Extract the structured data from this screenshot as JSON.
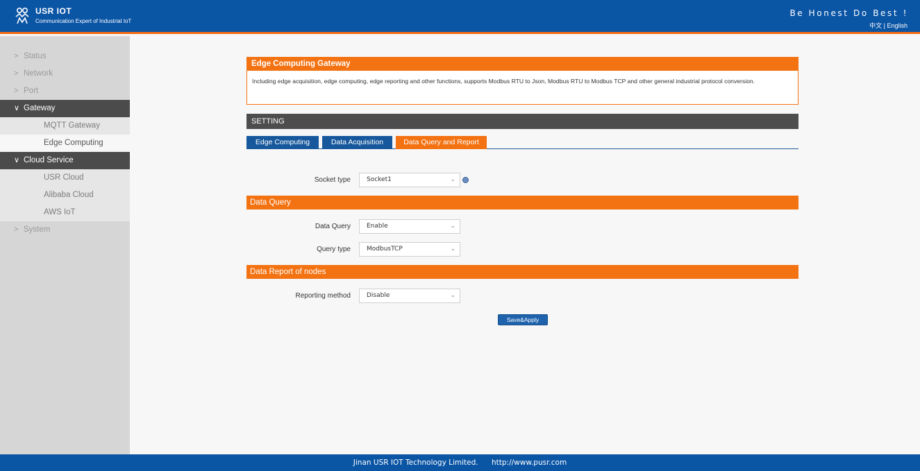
{
  "header": {
    "brand": "USR IOT",
    "tagline": "Communication Expert of Industrial IoT",
    "slogan": "Be Honest Do Best !",
    "lang_cn": "中文",
    "lang_sep": "|",
    "lang_en": "English"
  },
  "sidebar": {
    "items": [
      {
        "label": "Status",
        "chevron": ">"
      },
      {
        "label": "Network",
        "chevron": ">"
      },
      {
        "label": "Port",
        "chevron": ">"
      },
      {
        "label": "Gateway",
        "chevron": "∨"
      },
      {
        "label": "MQTT Gateway"
      },
      {
        "label": "Edge Computing"
      },
      {
        "label": "Cloud Service",
        "chevron": "∨"
      },
      {
        "label": "USR Cloud"
      },
      {
        "label": "Alibaba Cloud"
      },
      {
        "label": "AWS IoT"
      },
      {
        "label": "System",
        "chevron": ">"
      }
    ]
  },
  "main": {
    "panel_title": "Edge Computing Gateway",
    "panel_text": "Including edge acquisition, edge computing, edge reporting and other functions, supports Modbus RTU to Json, Modbus RTU to Modbus TCP and other general industrial protocol conversion.",
    "setting_title": "SETTING",
    "tabs": [
      {
        "label": "Edge Computing"
      },
      {
        "label": "Data Acquisition"
      },
      {
        "label": "Data Query and Report"
      }
    ],
    "socket_type_label": "Socket type",
    "socket_type_value": "Socket1",
    "data_query_section": "Data Query",
    "data_query_label": "Data Query",
    "data_query_value": "Enable",
    "query_type_label": "Query type",
    "query_type_value": "ModbusTCP",
    "report_section": "Data Report of nodes",
    "reporting_method_label": "Reporting method",
    "reporting_method_value": "Disable",
    "save_label": "Save&Apply",
    "select_arrow": "⌄"
  },
  "footer": {
    "company": "Jinan USR IOT Technology Limited.",
    "url": "http://www.pusr.com"
  },
  "colors": {
    "brand_blue": "#0b55a5",
    "accent_orange": "#f37212",
    "tab_blue": "#17589d",
    "dark_bar": "#4d4d4d"
  }
}
